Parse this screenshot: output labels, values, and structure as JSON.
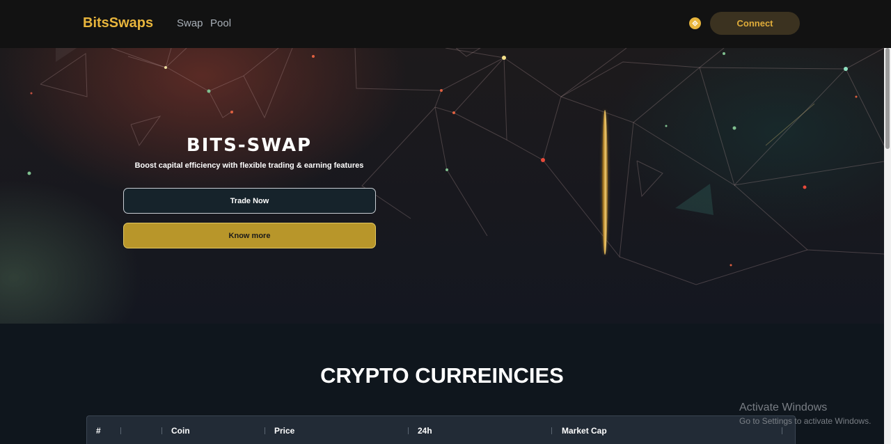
{
  "navbar": {
    "brand": "BitsSwaps",
    "links": [
      {
        "label": "Swap"
      },
      {
        "label": "Pool"
      }
    ],
    "network_icon": "bnb-coin-icon",
    "connect_label": "Connect"
  },
  "hero": {
    "title": "BITS-SWAP",
    "subtitle": "Boost capital efficiency with flexible trading & earning features",
    "trade_label": "Trade Now",
    "know_label": "Know more"
  },
  "crypto": {
    "title": "CRYPTO CURREINCIES",
    "columns": [
      "#",
      "",
      "Coin",
      "Price",
      "24h",
      "Market Cap"
    ]
  },
  "watermark": {
    "title": "Activate Windows",
    "subtitle": "Go to Settings to activate Windows."
  },
  "colors": {
    "accent": "#e8b53c",
    "navbar_bg": "#121212",
    "page_bg": "#0f161d",
    "know_more_bg": "#b8962a",
    "connect_bg": "#3b3220"
  }
}
